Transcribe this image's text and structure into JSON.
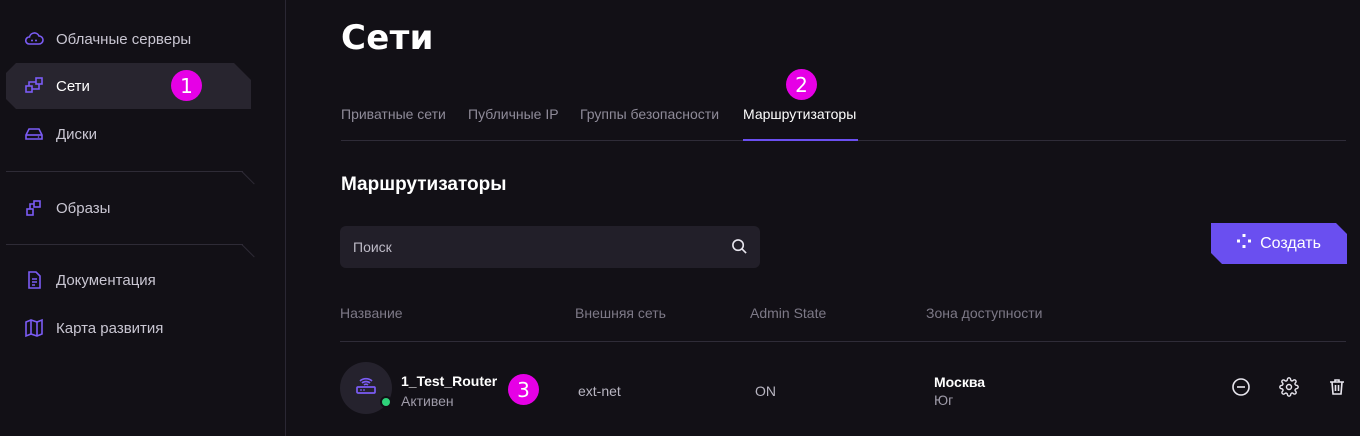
{
  "sidebar": {
    "items": [
      {
        "label": "Облачные серверы",
        "icon": "cloud-server-icon"
      },
      {
        "label": "Сети",
        "icon": "network-icon",
        "active": true
      },
      {
        "label": "Диски",
        "icon": "disk-icon"
      },
      {
        "label": "Образы",
        "icon": "images-icon"
      },
      {
        "label": "Документация",
        "icon": "document-icon"
      },
      {
        "label": "Карта развития",
        "icon": "map-icon"
      }
    ]
  },
  "annotations": [
    "1",
    "2",
    "3"
  ],
  "page": {
    "title": "Сети",
    "tabs": [
      {
        "label": "Приватные сети"
      },
      {
        "label": "Публичные IP"
      },
      {
        "label": "Группы безопасности"
      },
      {
        "label": "Маршрутизаторы",
        "active": true
      }
    ],
    "section_title": "Маршрутизаторы",
    "search_placeholder": "Поиск",
    "create_label": "Создать"
  },
  "table": {
    "columns": [
      "Название",
      "Внешняя сеть",
      "Admin State",
      "Зона доступности"
    ],
    "rows": [
      {
        "name": "1_Test_Router",
        "status": "Активен",
        "external_network": "ext-net",
        "admin_state": "ON",
        "zone": "Москва",
        "zone_sub": "Юг",
        "actions": [
          "disable-icon",
          "gear-icon",
          "trash-icon"
        ]
      }
    ]
  },
  "colors": {
    "accent": "#6a4ff0",
    "badge": "#e600e6",
    "status_active": "#2ed27a",
    "background": "#121016"
  }
}
